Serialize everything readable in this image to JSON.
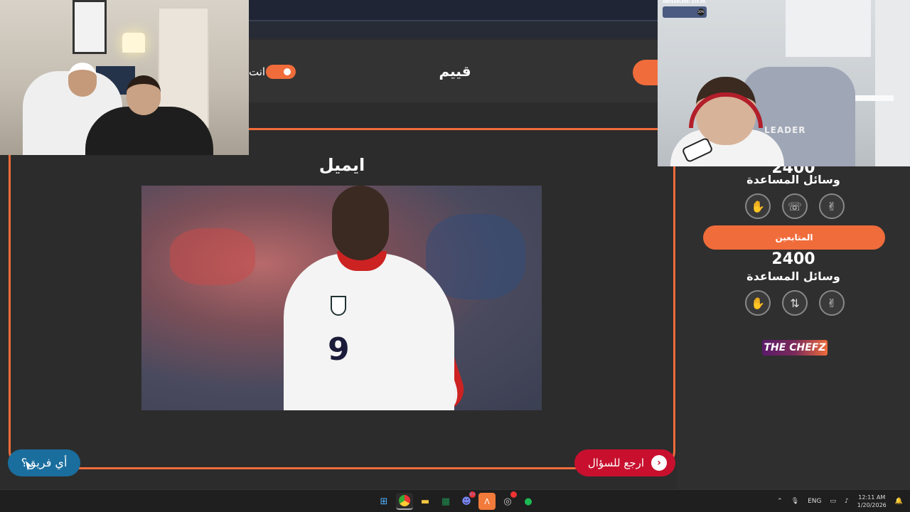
{
  "header": {
    "title": "قييم",
    "toggle_label": "انت"
  },
  "question": {
    "answer_title": "ايميل",
    "player_number": "9"
  },
  "panel": {
    "score_top_partial": "2400",
    "aids_label_1": "وسائل المساعدة",
    "team_name": "المتابعين",
    "score": "2400",
    "aids_label_2": "وسائل المساعدة",
    "aids_row1": [
      "hand-icon",
      "phone-icon",
      "peace-icon"
    ],
    "aids_row2": [
      "hand-icon",
      "swap-icon",
      "peace-icon"
    ],
    "logo": "THE CHEFZ"
  },
  "buttons": {
    "back_label": "ارجع للسؤال",
    "which_team_label": "أي فريق؟"
  },
  "webcam_right": {
    "donor_name": "ABOSARLEEB: $10.00",
    "donation_progress": "20%",
    "chair_brand": "LEADER"
  },
  "taskbar": {
    "language": "ENG",
    "time": "12:11 AM",
    "date": "1/20/2026",
    "discord_badge": "9+"
  },
  "colors": {
    "accent": "#f06c3b",
    "back_button": "#c8102e",
    "team_button": "#1a6e9e"
  }
}
